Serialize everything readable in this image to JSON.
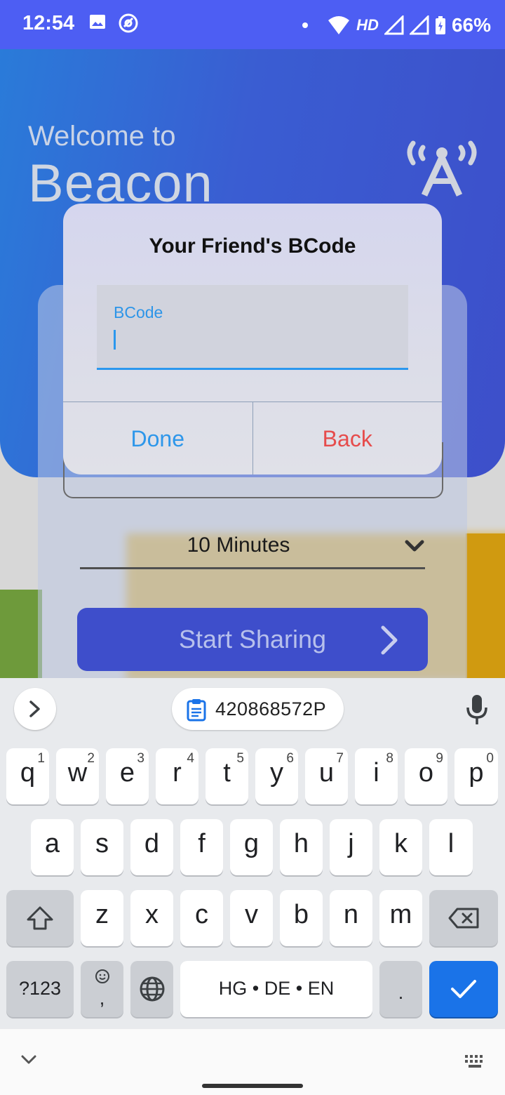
{
  "status_bar": {
    "time": "12:54",
    "network": "HD",
    "battery": "66%"
  },
  "app": {
    "welcome_text": "Welcome to",
    "app_name": "Beacon",
    "duration_select": {
      "value": "10 Minutes"
    },
    "start_button_label": "Start Sharing"
  },
  "dialog": {
    "title": "Your Friend's BCode",
    "field_label": "BCode",
    "field_value": "",
    "done_label": "Done",
    "back_label": "Back",
    "colors": {
      "done": "#2e97ea",
      "back": "#e64c4c"
    }
  },
  "keyboard": {
    "clipboard_suggestion": "420868572P",
    "row1": [
      {
        "ch": "q",
        "num": "1"
      },
      {
        "ch": "w",
        "num": "2"
      },
      {
        "ch": "e",
        "num": "3"
      },
      {
        "ch": "r",
        "num": "4"
      },
      {
        "ch": "t",
        "num": "5"
      },
      {
        "ch": "y",
        "num": "6"
      },
      {
        "ch": "u",
        "num": "7"
      },
      {
        "ch": "i",
        "num": "8"
      },
      {
        "ch": "o",
        "num": "9"
      },
      {
        "ch": "p",
        "num": "0"
      }
    ],
    "row2": [
      "a",
      "s",
      "d",
      "f",
      "g",
      "h",
      "j",
      "k",
      "l"
    ],
    "row3": [
      "z",
      "x",
      "c",
      "v",
      "b",
      "n",
      "m"
    ],
    "symbols_label": "?123",
    "space_label": "HG • DE • EN",
    "period_label": ".",
    "comma_label": ","
  }
}
